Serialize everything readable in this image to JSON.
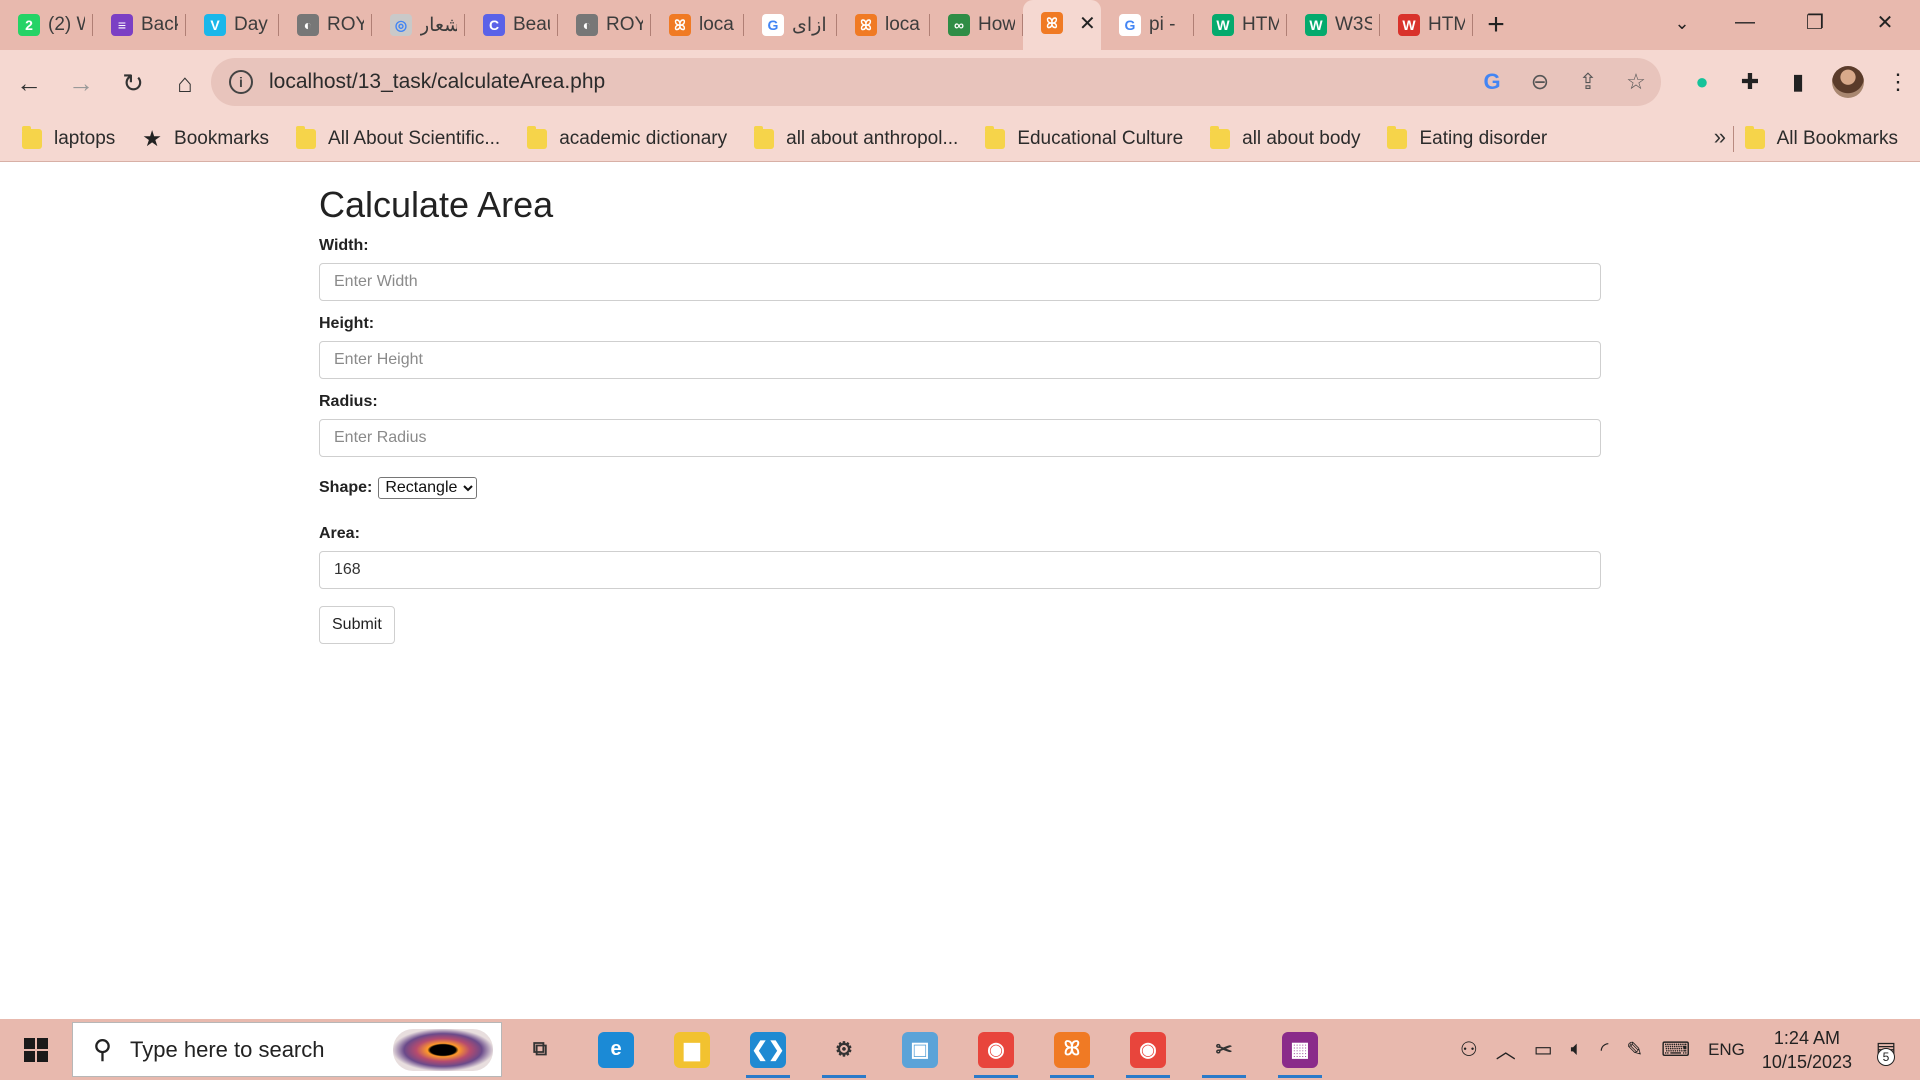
{
  "browser": {
    "tabs": [
      {
        "title": "(2) W",
        "icon": "whatsapp-icon",
        "color": "#25d366",
        "glyph": "2"
      },
      {
        "title": "Back",
        "icon": "list-app-icon",
        "color": "#7b3fc4",
        "glyph": "≡"
      },
      {
        "title": "Day",
        "icon": "vimeo-icon",
        "color": "#1ab7ea",
        "glyph": "V"
      },
      {
        "title": "ROY",
        "icon": "globe-icon",
        "color": "#777777",
        "glyph": "◐"
      },
      {
        "title": "أشعار",
        "icon": "owl-icon",
        "color": "#c9c9c9",
        "glyph": "◎"
      },
      {
        "title": "Beau",
        "icon": "canva-icon",
        "color": "#5a62e8",
        "glyph": "C"
      },
      {
        "title": "ROY",
        "icon": "globe-icon",
        "color": "#777777",
        "glyph": "◐"
      },
      {
        "title": "loca",
        "icon": "xampp-icon",
        "color": "#f07a24",
        "glyph": "ꕤ"
      },
      {
        "title": "ازای",
        "icon": "google-icon",
        "color": "#ffffff",
        "glyph": "G"
      },
      {
        "title": "loca",
        "icon": "xampp-icon",
        "color": "#f07a24",
        "glyph": "ꕤ"
      },
      {
        "title": "How",
        "icon": "geeksforgeeks-icon",
        "color": "#2f8d46",
        "glyph": "∞"
      },
      {
        "title": "",
        "icon": "xampp-icon",
        "color": "#f07a24",
        "glyph": "ꕤ",
        "active": true
      },
      {
        "title": "pi -",
        "icon": "google-icon",
        "color": "#ffffff",
        "glyph": "G"
      },
      {
        "title": "HTM",
        "icon": "w3schools-icon",
        "color": "#04aa6d",
        "glyph": "W"
      },
      {
        "title": "W3S",
        "icon": "w3schools-icon",
        "color": "#04aa6d",
        "glyph": "W"
      },
      {
        "title": "HTM",
        "icon": "w3schools-red-icon",
        "color": "#d9322b",
        "glyph": "W"
      }
    ],
    "url": "localhost/13_task/calculateArea.php",
    "bookmarks": [
      {
        "label": "laptops",
        "type": "folder"
      },
      {
        "label": "Bookmarks",
        "type": "star"
      },
      {
        "label": "All About Scientific...",
        "type": "folder"
      },
      {
        "label": "academic dictionary",
        "type": "folder"
      },
      {
        "label": "all about anthropol...",
        "type": "folder"
      },
      {
        "label": "Educational Culture",
        "type": "folder"
      },
      {
        "label": "all about body",
        "type": "folder"
      },
      {
        "label": "Eating disorder",
        "type": "folder"
      }
    ],
    "all_bookmarks_label": "All Bookmarks",
    "more_label": "»"
  },
  "form": {
    "title": "Calculate Area",
    "width_label": "Width:",
    "width_placeholder": "Enter Width",
    "height_label": "Height:",
    "height_placeholder": "Enter Height",
    "radius_label": "Radius:",
    "radius_placeholder": "Enter Radius",
    "shape_label": "Shape:",
    "shape_selected": "Rectangle",
    "area_label": "Area:",
    "area_value": "168",
    "submit_label": "Submit"
  },
  "taskbar": {
    "search_placeholder": "Type here to search",
    "apps": [
      {
        "name": "task-view-icon",
        "glyph": "⧉",
        "color": "transparent",
        "running": false
      },
      {
        "name": "edge-icon",
        "glyph": "e",
        "color": "#1b8ad6",
        "running": false
      },
      {
        "name": "file-explorer-icon",
        "glyph": "▆",
        "color": "#f2c230",
        "running": false
      },
      {
        "name": "vscode-icon",
        "glyph": "❮❯",
        "color": "#1f8ad2",
        "running": true
      },
      {
        "name": "settings-icon",
        "glyph": "⚙",
        "color": "transparent",
        "running": true
      },
      {
        "name": "control-panel-icon",
        "glyph": "▣",
        "color": "#5ba3d8",
        "running": false
      },
      {
        "name": "chrome-icon",
        "glyph": "◉",
        "color": "#e8453c",
        "running": true
      },
      {
        "name": "xampp-icon",
        "glyph": "ꕤ",
        "color": "#f07a24",
        "running": true
      },
      {
        "name": "chrome-profile-icon",
        "glyph": "◉",
        "color": "#e8453c",
        "running": true
      },
      {
        "name": "snipping-tool-icon",
        "glyph": "✂",
        "color": "transparent",
        "running": true
      },
      {
        "name": "winrar-icon",
        "glyph": "▦",
        "color": "#8a2b8a",
        "running": true
      }
    ],
    "language": "ENG",
    "time": "1:24 AM",
    "date": "10/15/2023",
    "notifications_count": "5"
  }
}
